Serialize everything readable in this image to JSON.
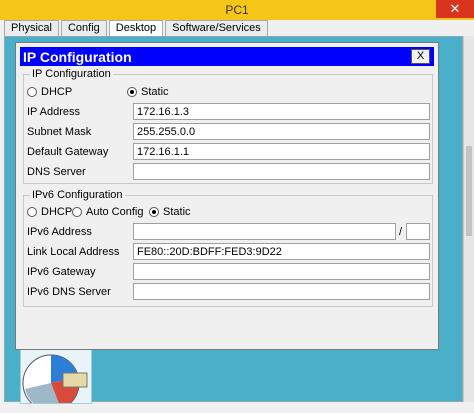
{
  "window": {
    "title": "PC1",
    "close_glyph": "✕"
  },
  "tabs": [
    {
      "label": "Physical"
    },
    {
      "label": "Config"
    },
    {
      "label": "Desktop",
      "active": true
    },
    {
      "label": "Software/Services"
    }
  ],
  "dialog": {
    "title": "IP Configuration",
    "close_label": "X",
    "ipv4": {
      "group_title": "IP Configuration",
      "dhcp_label": "DHCP",
      "static_label": "Static",
      "selected": "Static",
      "fields": [
        {
          "label": "IP Address",
          "value": "172.16.1.3"
        },
        {
          "label": "Subnet Mask",
          "value": "255.255.0.0"
        },
        {
          "label": "Default Gateway",
          "value": "172.16.1.1"
        },
        {
          "label": "DNS Server",
          "value": ""
        }
      ]
    },
    "ipv6": {
      "group_title": "IPv6 Configuration",
      "dhcp_label": "DHCP",
      "auto_label": "Auto Config",
      "static_label": "Static",
      "selected": "Static",
      "address_label": "IPv6 Address",
      "address_value": "",
      "separator": "/",
      "prefix_value": "",
      "link_local_label": "Link Local Address",
      "link_local_value": "FE80::20D:BDFF:FED3:9D22",
      "gateway_label": "IPv6 Gateway",
      "gateway_value": "",
      "dns_label": "IPv6 DNS Server",
      "dns_value": ""
    }
  },
  "colors": {
    "titlebar": "#f5c518",
    "dialog_header": "#0000ff",
    "desktop": "#4ab0c9",
    "close_button": "#d9341e"
  }
}
